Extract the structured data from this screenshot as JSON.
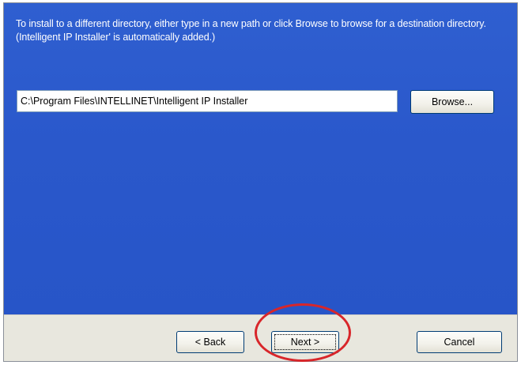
{
  "dialog": {
    "instructions": "To install to a different directory, either type in a new path or click Browse to browse for a destination directory. (Intelligent IP Installer' is automatically added.)",
    "install_path": "C:\\Program Files\\INTELLINET\\Intelligent IP Installer"
  },
  "buttons": {
    "browse_label": "Browse...",
    "back_label": "< Back",
    "next_label": "Next >",
    "cancel_label": "Cancel"
  },
  "colors": {
    "content_background": "#2f5fd0",
    "footer_background": "#e8e7de",
    "highlight_ring": "#d8262a"
  }
}
